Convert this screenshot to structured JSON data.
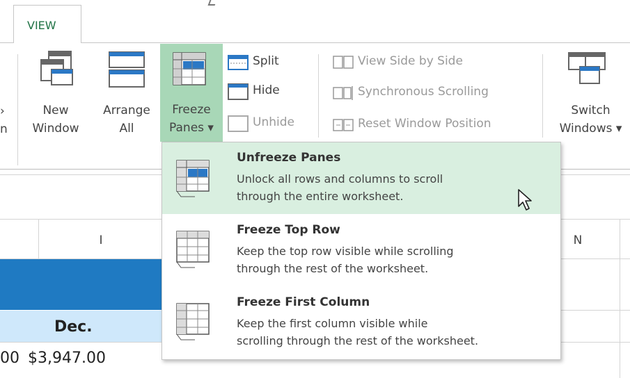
{
  "tabs": {
    "active": "VIEW"
  },
  "ribbon": {
    "partial_left": [
      "›",
      "n"
    ],
    "new_window": [
      "New",
      "Window"
    ],
    "arrange_all": [
      "Arrange",
      "All"
    ],
    "freeze_panes": [
      "Freeze",
      "Panes ▾"
    ],
    "split": "Split",
    "hide": "Hide",
    "unhide": "Unhide",
    "view_side_by_side": "View Side by Side",
    "synchronous_scrolling": "Synchronous Scrolling",
    "reset_window_position": "Reset Window Position",
    "switch_windows": [
      "Switch",
      "Windows ▾"
    ]
  },
  "menu": {
    "items": [
      {
        "title": "Unfreeze Panes",
        "desc1": "Unlock all rows and columns to scroll",
        "desc2": "through the entire worksheet.",
        "icon": "unfreeze-panes-icon"
      },
      {
        "title": "Freeze Top Row",
        "desc1": "Keep the top row visible while scrolling",
        "desc2": "through the rest of the worksheet.",
        "icon": "freeze-top-row-icon"
      },
      {
        "title": "Freeze First Column",
        "desc1": "Keep the first column visible while",
        "desc2": "scrolling through the rest of the worksheet.",
        "icon": "freeze-first-column-icon"
      }
    ]
  },
  "sheet": {
    "col_i": "I",
    "col_n": "N",
    "header_dec": "Dec.",
    "partial_value": "00",
    "dec_value": "$3,947.00"
  },
  "colors": {
    "accent": "#217346",
    "freeze_highlight": "#a8d7b7",
    "menu_highlight": "#d9efe0",
    "header_blue": "#1f7ac2",
    "light_blue": "#cfe8fb"
  }
}
